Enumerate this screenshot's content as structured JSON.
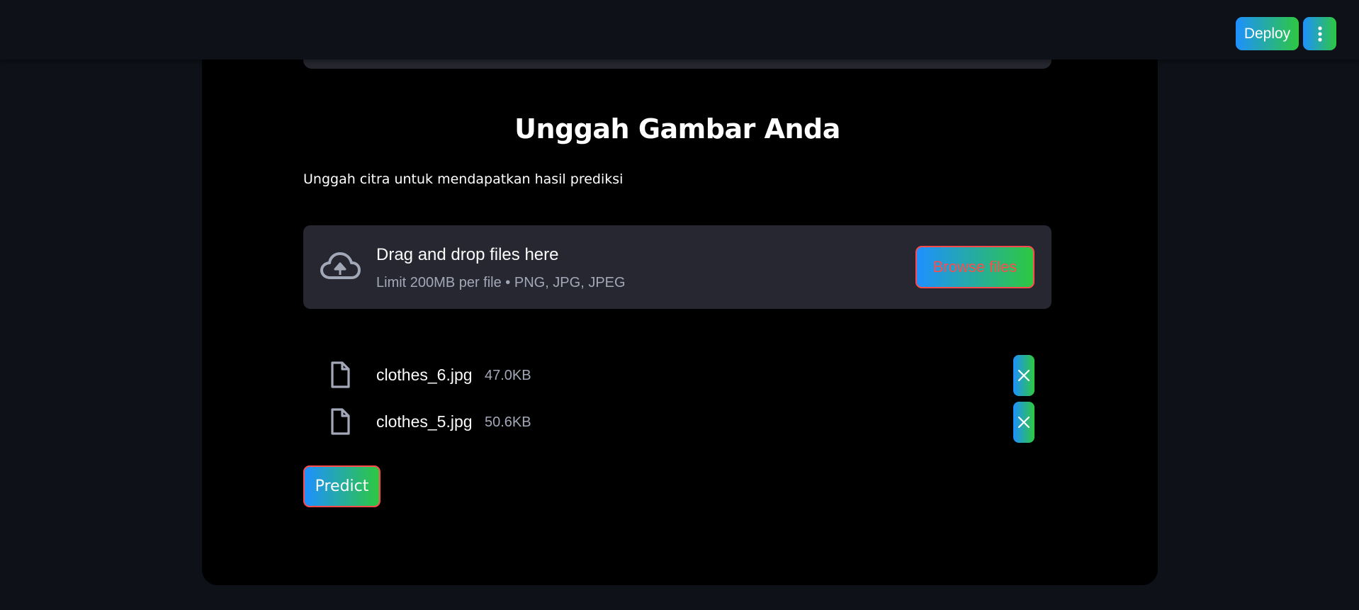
{
  "header": {
    "deploy_label": "Deploy",
    "menu_icon": "kebab-menu-icon"
  },
  "main": {
    "title": "Unggah Gambar Anda",
    "subtitle": "Unggah citra untuk mendapatkan hasil prediksi",
    "uploader": {
      "drop_title": "Drag and drop files here",
      "drop_limit": "Limit 200MB per file • PNG, JPG, JPEG",
      "browse_label": "Browse files",
      "upload_icon": "cloud-upload-icon"
    },
    "files": [
      {
        "name": "clothes_6.jpg",
        "size": "47.0KB"
      },
      {
        "name": "clothes_5.jpg",
        "size": "50.6KB"
      }
    ],
    "predict_label": "Predict"
  },
  "colors": {
    "background": "#0e1117",
    "card": "#000000",
    "panel": "#262730",
    "accent_red": "#ff4b4b",
    "gradient_start": "#1e90ff",
    "gradient_end": "#2ec840"
  }
}
